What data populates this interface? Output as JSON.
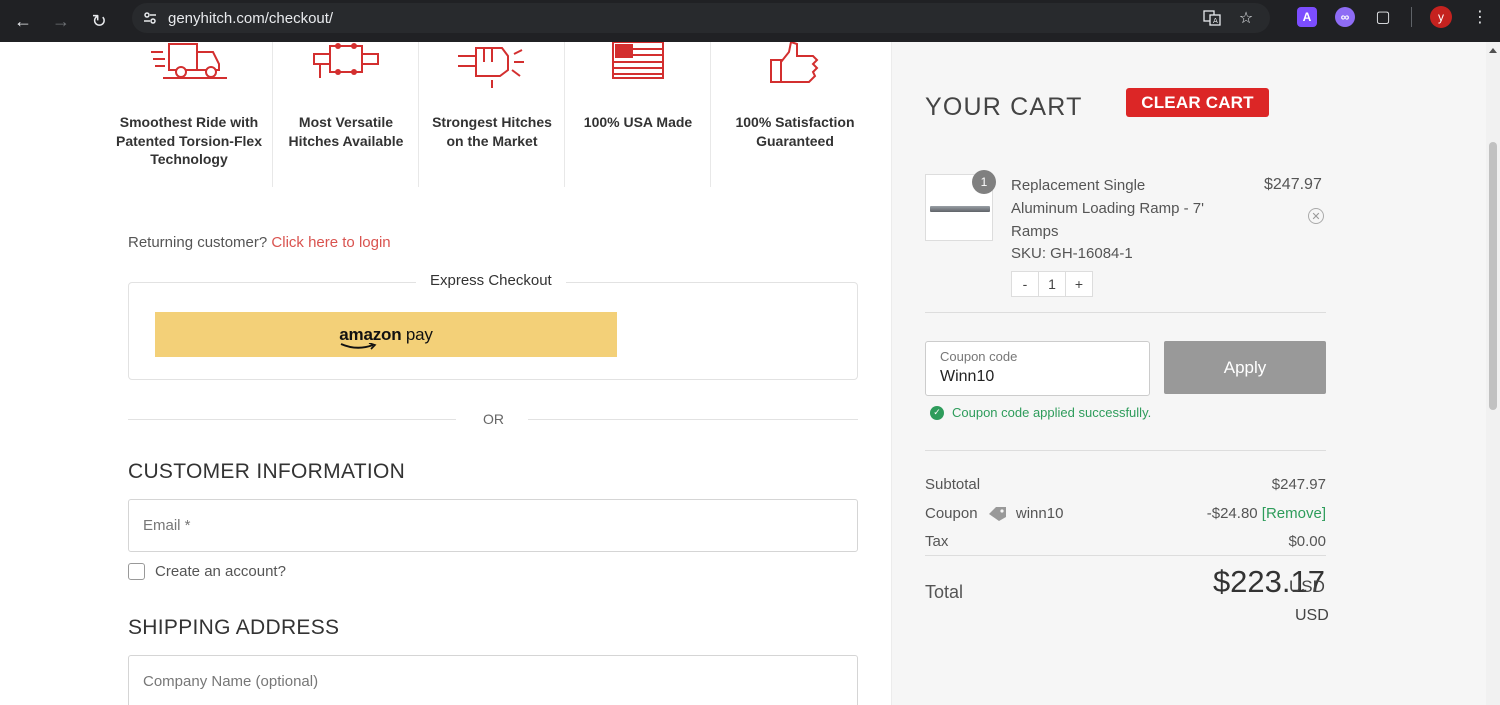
{
  "browser": {
    "url": "genyhitch.com/checkout/",
    "avatar_letter": "y",
    "ext_letter": "A"
  },
  "features": [
    {
      "icon": "trailer-icon",
      "label": "Smoothest Ride with Patented Torsion-Flex Technology"
    },
    {
      "icon": "hitch-icon",
      "label": "Most Versatile Hitches Available"
    },
    {
      "icon": "fist-icon",
      "label": "Strongest Hitches on the Market"
    },
    {
      "icon": "usa-flag-icon",
      "label": "100% USA Made"
    },
    {
      "icon": "thumbs-up-icon",
      "label": "100% Satisfaction Guaranteed"
    }
  ],
  "checkout": {
    "returning_text": "Returning customer?",
    "login_link": "Click here to login",
    "express_label": "Express Checkout",
    "amazon_brand": "amazon",
    "amazon_pay": "pay",
    "or_text": "OR",
    "customer_info_title": "CUSTOMER INFORMATION",
    "email_placeholder": "Email *",
    "create_account_label": "Create an account?",
    "shipping_title": "SHIPPING ADDRESS",
    "company_placeholder": "Company Name (optional)"
  },
  "cart": {
    "title": "YOUR CART",
    "clear_label": "CLEAR CART",
    "item": {
      "quantity_badge": "1",
      "name": "Replacement Single Aluminum Loading Ramp - 7' Ramps",
      "sku": "SKU: GH-16084-1",
      "price": "$247.97",
      "qty_minus": "-",
      "qty_value": "1",
      "qty_plus": "+"
    },
    "coupon": {
      "placeholder": "Coupon code",
      "value": "Winn10",
      "apply_label": "Apply",
      "success_message": "Coupon code applied successfully."
    },
    "summary": {
      "subtotal_label": "Subtotal",
      "subtotal_value": "$247.97",
      "coupon_label": "Coupon",
      "coupon_code": "winn10",
      "coupon_value": "-$24.80",
      "coupon_remove": "[Remove]",
      "tax_label": "Tax",
      "tax_value": "$0.00",
      "total_label": "Total",
      "total_value": "$223.17",
      "total_currency": "USD",
      "total_currency_repeat": "USD"
    }
  },
  "colors": {
    "brand_red": "#dc2626",
    "success_green": "#2e9c5b",
    "amazon_yellow": "#f3d078"
  }
}
